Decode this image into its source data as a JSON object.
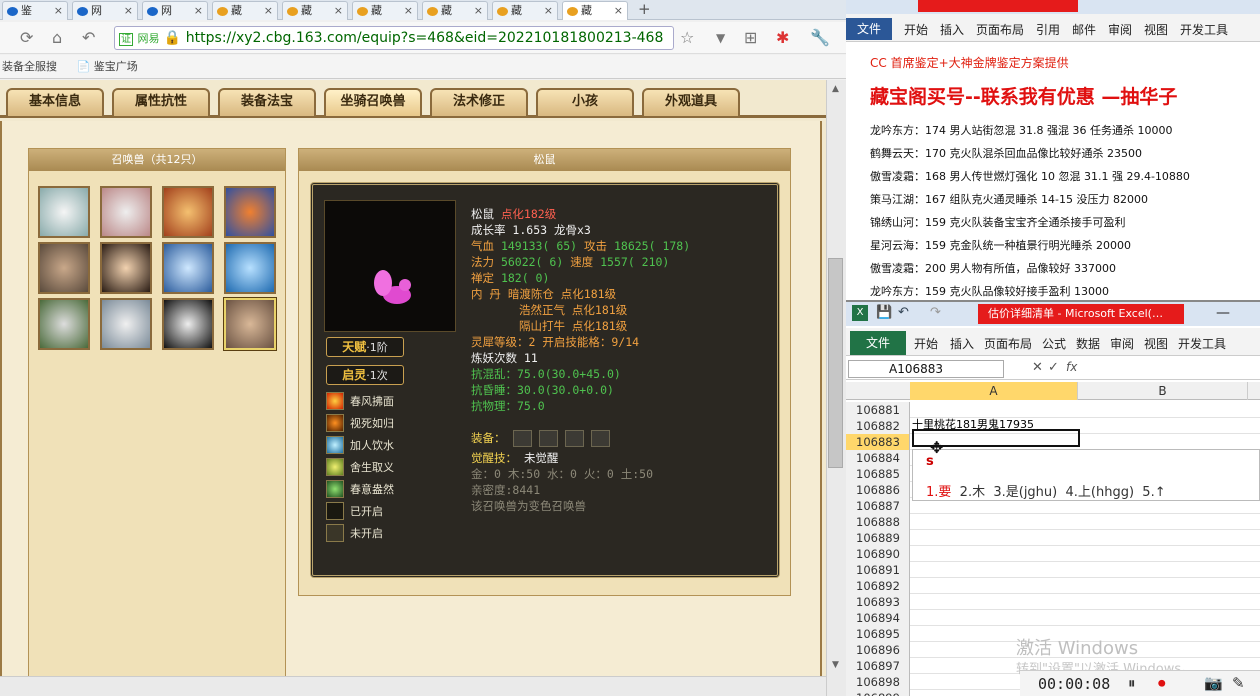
{
  "browser": {
    "tabs": [
      {
        "label": "鉴",
        "active": false
      },
      {
        "label": "网",
        "active": false
      },
      {
        "label": "网",
        "active": false
      },
      {
        "label": "藏",
        "active": false
      },
      {
        "label": "藏",
        "active": false
      },
      {
        "label": "藏",
        "active": false
      },
      {
        "label": "藏",
        "active": false
      },
      {
        "label": "藏",
        "active": false
      },
      {
        "label": "藏",
        "active": true
      }
    ],
    "new_tab": "+",
    "url_prefix": "网易",
    "url": "https://xy2.cbg.163.com/equip?s=468&eid=202210181800213-468",
    "bookmarks": [
      "装备全服搜",
      "鉴宝广场"
    ]
  },
  "game": {
    "tabs": [
      "基本信息",
      "属性抗性",
      "装备法宝",
      "坐骑召唤兽",
      "法术修正",
      "小孩",
      "外观道具"
    ],
    "summon_header": "召唤兽（共12只）",
    "detail_header": "松鼠",
    "pet": {
      "name": "松鼠",
      "evolution": "点化182级",
      "growth_label": "成长率 1.653 龙骨x3",
      "hp_label": "气血",
      "hp_value": "149133( 65)",
      "atk_label": "攻击",
      "atk_value": "18625( 178)",
      "mp_label": "法力",
      "mp_value": "56022( 6)",
      "spd_label": "速度",
      "spd_value": "1557( 210)",
      "zen_label": "禅定",
      "zen_value": "182( 0)",
      "elixir_label": "内  丹",
      "elixirs": [
        "暗渡陈仓 点化181级",
        "浩然正气 点化181级",
        "隔山打牛 点化181级"
      ],
      "lingxi": "灵犀等级：2 开启技能格：9/14",
      "lianyao": "炼妖次数 11",
      "kanghunluan": "抗混乱：75.0(30.0+45.0)",
      "kanghunshui": "抗昏睡：30.0(30.0+0.0)",
      "kangwuli": "抗物理：75.0",
      "equip_label": "装备：",
      "awaken_label": "觉醒技：",
      "awaken_value": "未觉醒",
      "elements": "金：0 木:50 水：0 火：0 土:50",
      "intimacy": "亲密度:8441",
      "note": "该召唤兽为变色召唤兽"
    },
    "badges": [
      {
        "title": "天赋",
        "suffix": "·1阶"
      },
      {
        "title": "启灵",
        "suffix": "·1次"
      }
    ],
    "skills": [
      "春风拂面",
      "视死如归",
      "加人饮水",
      "舍生取义",
      "春意盎然",
      "已开启",
      "未开启"
    ]
  },
  "word": {
    "file_tab": "文件",
    "tabs": [
      "开始",
      "插入",
      "页面布局",
      "引用",
      "邮件",
      "审阅",
      "视图",
      "开发工具"
    ],
    "lines": [
      "CC 首席鉴定+大神金牌鉴定方案提供",
      "藏宝阁买号--联系我有优惠 —抽华子",
      "龙吟东方：174 男人站街忽混 31.8 强混 36 任务通杀 10000",
      "鹤舞云天：170 克火队混杀回血品像比较好通杀 23500",
      "傲雪凌霜：168 男人传世燃灯强化 10 忽混 31.1 强 29.4-10880",
      "策马江湖：167 组队克火通灵睡杀 14-15 没压力 82000",
      "锦绣山河：159 克火队装备宝宝齐全通杀接手可盈利",
      "星河云海：159 克金队统一种植景行明光睡杀 20000",
      "傲雪凌霜：200 男人物有所值，品像较好 337000",
      "龙吟东方：159 克火队品像较好接手盈利 13000"
    ]
  },
  "excel": {
    "title": "估价详细清单 - Microsoft Excel(…",
    "file_tab": "文件",
    "tabs": [
      "开始",
      "插入",
      "页面布局",
      "公式",
      "数据",
      "审阅",
      "视图",
      "开发工具"
    ],
    "namebox": "A106883",
    "col_a": "A",
    "col_b": "B",
    "cell_text": "十里桃花181男鬼17935",
    "rows": [
      "106881",
      "106882",
      "106883",
      "106884",
      "106885",
      "106886",
      "106887",
      "106888",
      "106889",
      "106890",
      "106891",
      "106892",
      "106893",
      "106894",
      "106895",
      "106896",
      "106897",
      "106898",
      "106899"
    ],
    "ime_input": "s",
    "ime_candidates": [
      "1.要",
      "2.木",
      "3.是(jghu)",
      "4.上(hhgg)",
      "5.↑"
    ]
  },
  "watermark": {
    "line1": "激活 Windows",
    "line2": "转到\"设置\"以激活 Windows。"
  },
  "recorder": {
    "time": "00:00:08"
  },
  "colors": {
    "accent_red": "#e51b1b",
    "green": "#4fc24f",
    "orange_red": "#ff6050"
  }
}
